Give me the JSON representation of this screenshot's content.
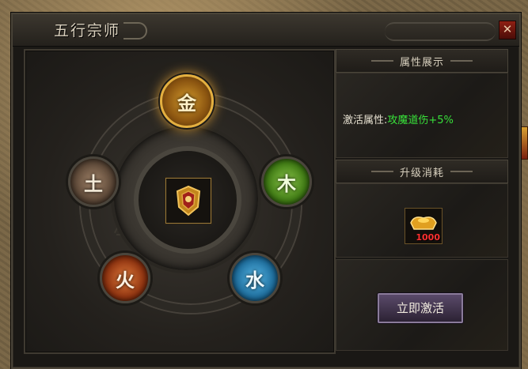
{
  "window": {
    "title": "五行宗师",
    "close_label": "✕"
  },
  "elements": {
    "metal": "金",
    "wood": "木",
    "water": "水",
    "fire": "火",
    "earth": "土"
  },
  "attributes": {
    "header": "属性展示",
    "label": "激活属性:",
    "value": "攻魔道伤+5%"
  },
  "upgrade": {
    "header": "升级消耗",
    "item_count": "1000"
  },
  "activate_button": "立即激活",
  "colors": {
    "attr_value": "#38e03a",
    "item_count": "#ff3030",
    "metal_glow": "#f5b03a"
  }
}
